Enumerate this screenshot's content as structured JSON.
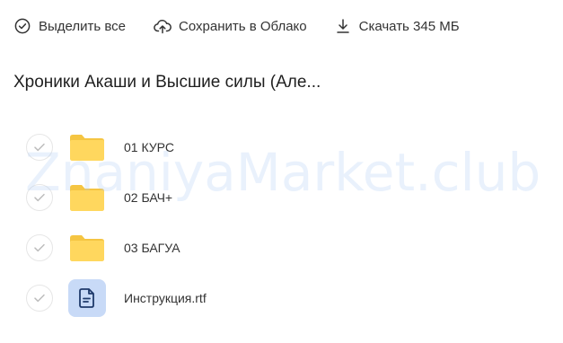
{
  "toolbar": {
    "select_all_label": "Выделить все",
    "save_cloud_label": "Сохранить в Облако",
    "download_label": "Скачать 345 МБ"
  },
  "page": {
    "title": "Хроники Акаши и Высшие силы (Але..."
  },
  "files": [
    {
      "name": "01 КУРС",
      "type": "folder",
      "icon": "folder-icon"
    },
    {
      "name": "02 БАЧ+",
      "type": "folder",
      "icon": "folder-icon"
    },
    {
      "name": "03 БАГУА",
      "type": "folder",
      "icon": "folder-icon"
    },
    {
      "name": "Инструкция.rtf",
      "type": "document",
      "icon": "document-icon"
    }
  ],
  "watermark": "ZnaniyaMarket.club",
  "colors": {
    "folder": "#FFD75E",
    "folder_tab": "#F5C542",
    "doc_bg": "#C8DAF7",
    "doc_icon": "#1F3A6B",
    "check": "#BDBDBD",
    "text": "#333333"
  }
}
